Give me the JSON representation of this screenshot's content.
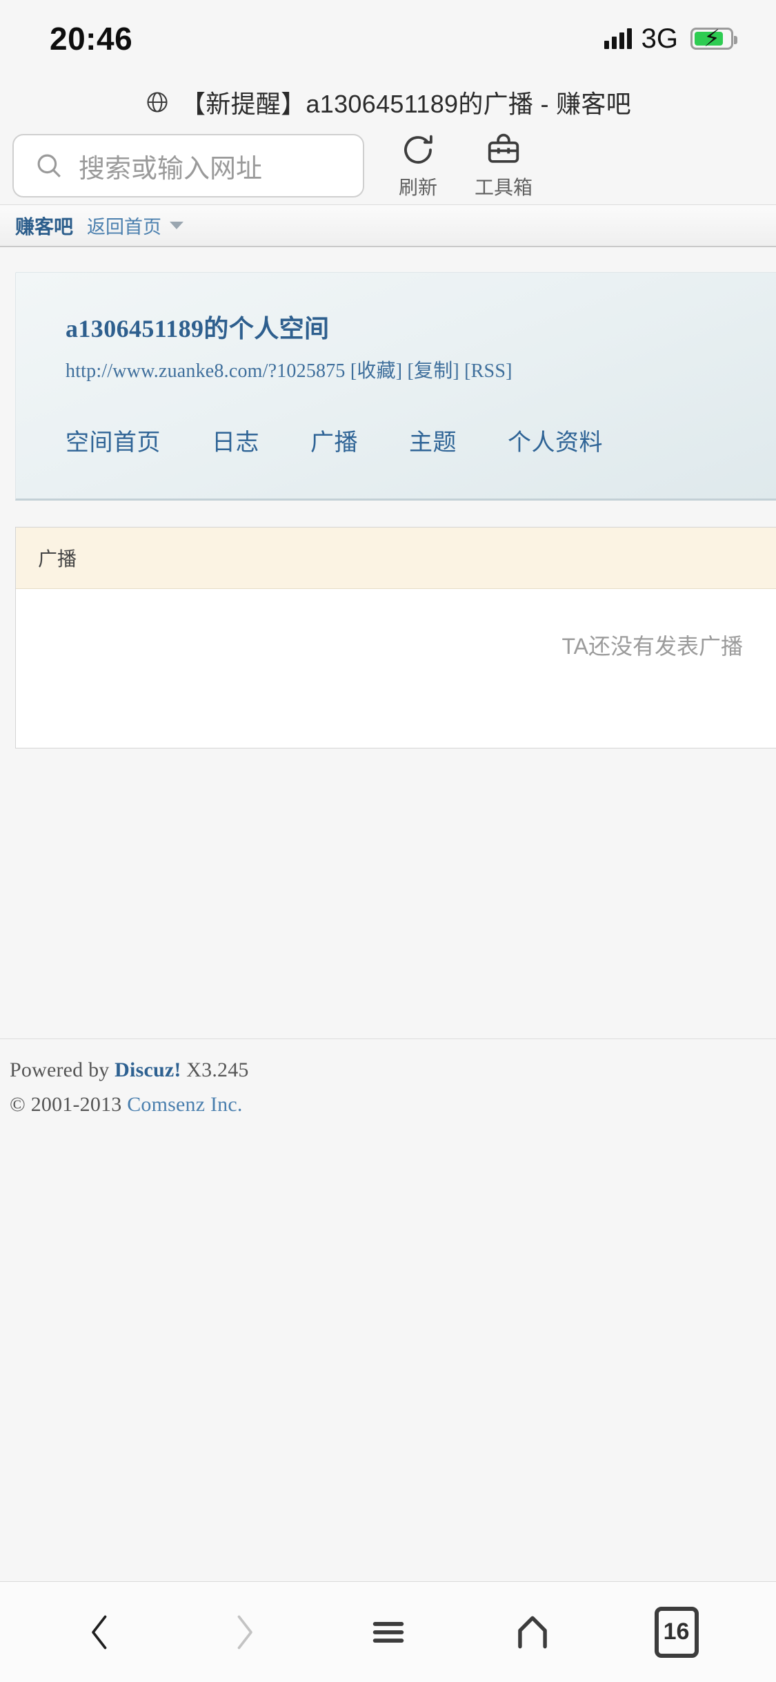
{
  "status_bar": {
    "time": "20:46",
    "network": "3G",
    "signal_icon": "signal-bars-icon",
    "battery_icon": "battery-charging-icon",
    "battery_level_percent": 74
  },
  "browser": {
    "page_title": "【新提醒】a1306451189的广播 - 赚客吧",
    "title_icon": "globe-icon",
    "search": {
      "placeholder": "搜索或输入网址",
      "value": "",
      "icon": "search-icon"
    },
    "actions": [
      {
        "label": "刷新",
        "icon": "refresh-icon"
      },
      {
        "label": "工具箱",
        "icon": "toolbox-icon"
      }
    ]
  },
  "site_nav": {
    "brand": "赚客吧",
    "home_link": "返回首页",
    "caret_icon": "chevron-down-icon"
  },
  "profile": {
    "name": "a1306451189的个人空间",
    "url": "http://www.zuanke8.com/?1025875",
    "url_actions": "[收藏] [复制] [RSS]",
    "tabs": [
      {
        "label": "空间首页"
      },
      {
        "label": "日志"
      },
      {
        "label": "广播"
      },
      {
        "label": "主题"
      },
      {
        "label": "个人资料"
      }
    ]
  },
  "panel": {
    "header": "广播",
    "empty_message": "TA还没有发表广播"
  },
  "footer": {
    "powered_prefix": "Powered by ",
    "powered_brand": "Discuz!",
    "powered_version": " X3.245",
    "copyright_prefix": "© 2001-2013 ",
    "copyright_company": "Comsenz Inc."
  },
  "bottom_bar": {
    "back": "back-icon",
    "forward": "forward-icon",
    "menu": "menu-icon",
    "home": "home-icon",
    "tab_count": "16"
  },
  "colors": {
    "link_blue": "#2f6496",
    "brand_blue": "#2b5d8b",
    "panel_header_bg": "#fbf3e3",
    "battery_green": "#2ecc52",
    "page_bg": "#f6f6f6"
  }
}
